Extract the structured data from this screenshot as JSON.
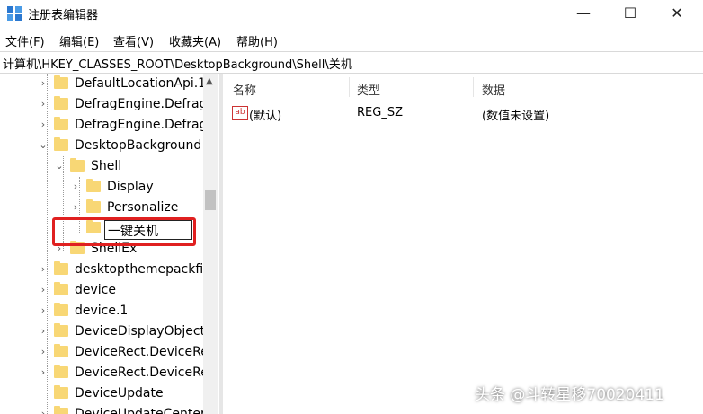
{
  "window": {
    "title": "注册表编辑器",
    "minimize_glyph": "—",
    "maximize_glyph": "☐",
    "close_glyph": "✕"
  },
  "menu": [
    "文件(F)",
    "编辑(E)",
    "查看(V)",
    "收藏夹(A)",
    "帮助(H)"
  ],
  "address": "计算机\\HKEY_CLASSES_ROOT\\DesktopBackground\\Shell\\关机",
  "tree": {
    "items": [
      {
        "label": "DefaultLocationApi.1",
        "expander": "›"
      },
      {
        "label": "DefragEngine.Defrag",
        "expander": "›"
      },
      {
        "label": "DefragEngine.Defrag",
        "expander": "›"
      },
      {
        "label": "DesktopBackground",
        "expander": "⌄"
      },
      {
        "label": "Shell",
        "expander": "⌄"
      },
      {
        "label": "Display",
        "expander": "›"
      },
      {
        "label": "Personalize",
        "expander": "›"
      },
      {
        "label": "",
        "expander": ""
      },
      {
        "label": "ShellEx",
        "expander": "›"
      },
      {
        "label": "desktopthemepackfil",
        "expander": "›"
      },
      {
        "label": "device",
        "expander": "›"
      },
      {
        "label": "device.1",
        "expander": "›"
      },
      {
        "label": "DeviceDisplayObject",
        "expander": "›"
      },
      {
        "label": "DeviceRect.DeviceRec",
        "expander": "›"
      },
      {
        "label": "DeviceRect.DeviceRec",
        "expander": "›"
      },
      {
        "label": "DeviceUpdate",
        "expander": ""
      },
      {
        "label": "DeviceUpdateCenter",
        "expander": "›"
      }
    ],
    "rename_value": "一键关机",
    "scroll_up_glyph": "▲"
  },
  "list": {
    "columns": [
      "名称",
      "类型",
      "数据"
    ],
    "rows": [
      {
        "name": "(默认)",
        "type": "REG_SZ",
        "data": "(数值未设置)",
        "icon": "ab"
      }
    ]
  },
  "watermark": "头条 @斗转星移70020411",
  "colors": {
    "folder": "#f8d775",
    "highlight": "#e02020"
  }
}
